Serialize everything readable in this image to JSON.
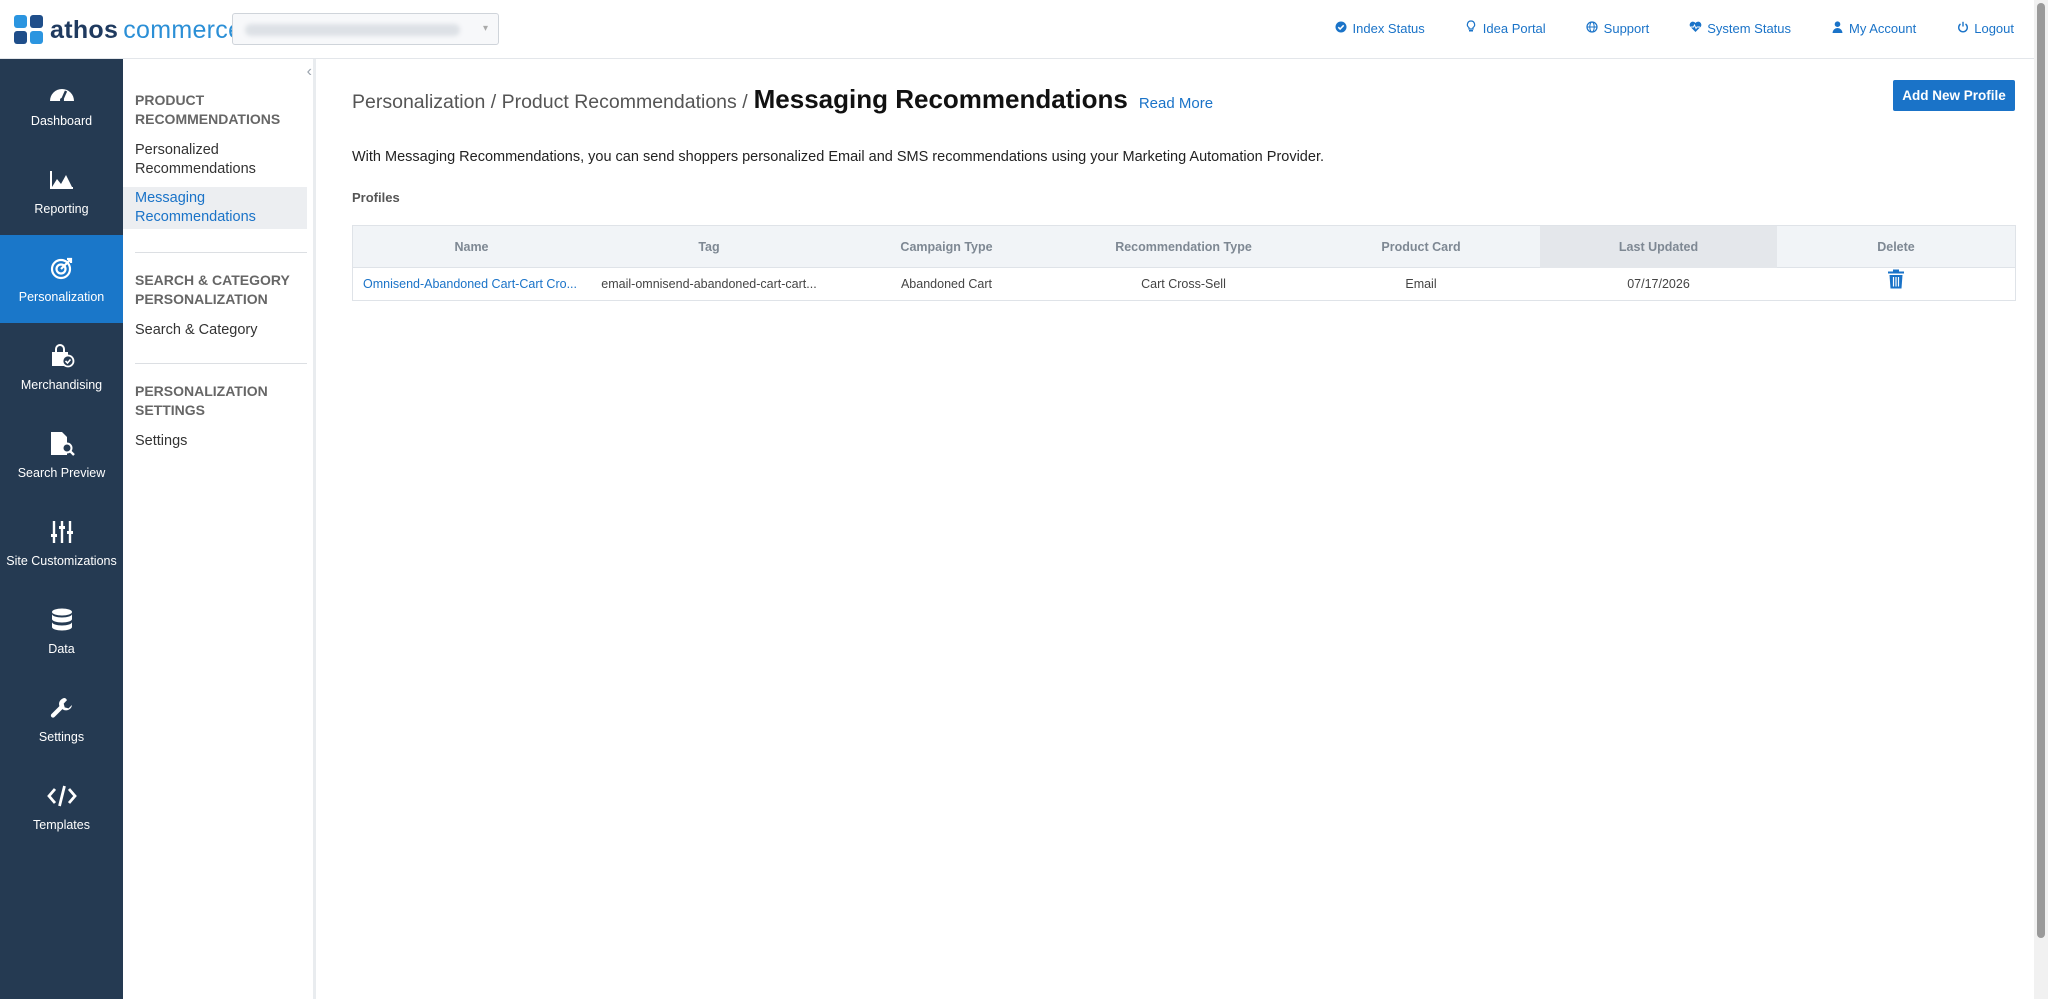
{
  "brand": {
    "name_bold": "athos",
    "name_light": "commerce"
  },
  "site_selector": {
    "value": ""
  },
  "topnav": [
    {
      "key": "index-status",
      "icon": "check-circle-icon",
      "label": "Index Status"
    },
    {
      "key": "idea-portal",
      "icon": "lightbulb-icon",
      "label": "Idea Portal"
    },
    {
      "key": "support",
      "icon": "globe-icon",
      "label": "Support"
    },
    {
      "key": "system-status",
      "icon": "heartbeat-icon",
      "label": "System Status"
    },
    {
      "key": "my-account",
      "icon": "user-icon",
      "label": "My Account"
    },
    {
      "key": "logout",
      "icon": "power-icon",
      "label": "Logout"
    }
  ],
  "sidenav": [
    {
      "key": "dashboard",
      "icon": "speedometer-icon",
      "label": "Dashboard",
      "active": false
    },
    {
      "key": "reporting",
      "icon": "area-chart-icon",
      "label": "Reporting",
      "active": false
    },
    {
      "key": "personalization",
      "icon": "target-icon",
      "label": "Personalization",
      "active": true
    },
    {
      "key": "merchandising",
      "icon": "shopping-bag-icon",
      "label": "Merchandising",
      "active": false
    },
    {
      "key": "search-preview",
      "icon": "document-search-icon",
      "label": "Search Preview",
      "active": false
    },
    {
      "key": "site-customizations",
      "icon": "sliders-icon",
      "label": "Site Customizations",
      "active": false
    },
    {
      "key": "data",
      "icon": "database-icon",
      "label": "Data",
      "active": false
    },
    {
      "key": "settings",
      "icon": "wrench-icon",
      "label": "Settings",
      "active": false
    },
    {
      "key": "templates",
      "icon": "code-icon",
      "label": "Templates",
      "active": false
    }
  ],
  "subnav": {
    "section1": "PRODUCT RECOMMENDATIONS",
    "item1": "Personalized Recommendations",
    "item2": "Messaging Recommendations",
    "section2": "SEARCH & CATEGORY PERSONALIZATION",
    "item3": "Search & Category",
    "section3": "PERSONALIZATION SETTINGS",
    "item4": "Settings"
  },
  "page": {
    "breadcrumb": "Personalization / Product Recommendations /",
    "title": "Messaging Recommendations",
    "read_more": "Read More",
    "add_button": "Add New Profile",
    "description": "With Messaging Recommendations, you can send shoppers personalized Email and SMS recommendations using your Marketing Automation Provider.",
    "profiles_label": "Profiles"
  },
  "table": {
    "columns": [
      "Name",
      "Tag",
      "Campaign Type",
      "Recommendation Type",
      "Product Card",
      "Last Updated",
      "Delete"
    ],
    "sorted_column": "Last Updated",
    "rows": [
      {
        "name": "Omnisend-Abandoned Cart-Cart Cro...",
        "tag": "email-omnisend-abandoned-cart-cart...",
        "campaign_type": "Abandoned Cart",
        "recommendation_type": "Cart Cross-Sell",
        "product_card": "Email",
        "last_updated": "07/17/2026",
        "delete_icon": "trash-icon"
      }
    ]
  },
  "colors": {
    "accent": "#1a73c8",
    "sidebar": "#253a52",
    "active_nav": "#1a77c9"
  }
}
